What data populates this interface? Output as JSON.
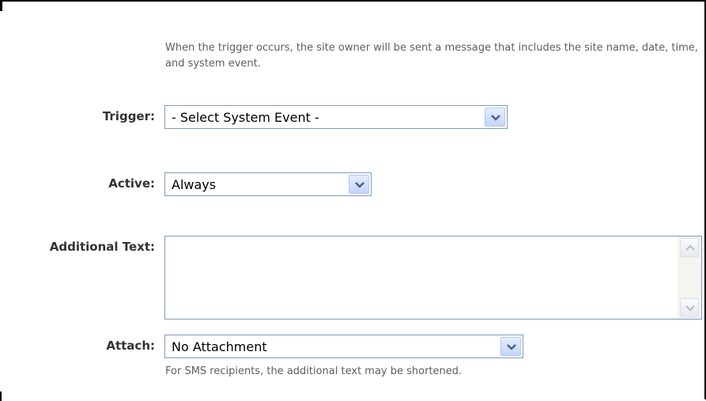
{
  "intro_text": "When the trigger occurs, the site owner will be sent a message that includes the site name, date, time, and system event.",
  "trigger": {
    "label": "Trigger:",
    "value": "- Select System Event -"
  },
  "active": {
    "label": "Active:",
    "value": "Always"
  },
  "additional_text": {
    "label": "Additional Text:",
    "value": ""
  },
  "attach": {
    "label": "Attach:",
    "value": "No Attachment"
  },
  "hint_text": "For SMS recipients, the additional text may be shortened.",
  "colors": {
    "border": "#7f9db9",
    "hint_text": "#5e5e5e",
    "dropdown_button": "#c5d5fc",
    "arrow": "#4d6185"
  },
  "icons": {
    "dropdown": "chevron-down-icon",
    "scroll_up": "arrow-up-icon",
    "scroll_down": "arrow-down-icon"
  }
}
